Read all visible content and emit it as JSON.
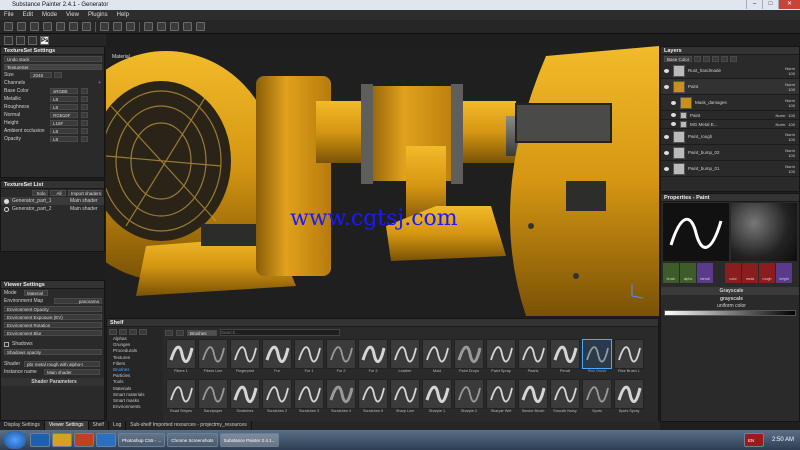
{
  "window": {
    "title": "Substance Painter 2.4.1 - Generator",
    "controls": [
      "–",
      "□",
      "✕"
    ]
  },
  "menu": [
    "File",
    "Edit",
    "Mode",
    "View",
    "Plugins",
    "Help"
  ],
  "toolbar2": {
    "ps_label": "Ps"
  },
  "textureset_settings": {
    "title": "TextureSet Settings",
    "undo_stack": "Undo stack",
    "textureset": "TextureSet",
    "size_label": "Size",
    "size_value": "2048",
    "channels_label": "Channels",
    "channels": [
      {
        "name": "Base Color",
        "format": "sRGB8"
      },
      {
        "name": "Metallic",
        "format": "L8"
      },
      {
        "name": "Roughness",
        "format": "L8"
      },
      {
        "name": "Normal",
        "format": "RGB16F"
      },
      {
        "name": "Height",
        "format": "L16F"
      },
      {
        "name": "Ambient occlusion",
        "format": "L8"
      },
      {
        "name": "Opacity",
        "format": "L8"
      }
    ]
  },
  "textureset_list": {
    "title": "TextureSet List",
    "buttons": [
      "Solo",
      "All",
      "Import shaders"
    ],
    "items": [
      {
        "name": "Generator_part_1",
        "shader": "Main shader"
      },
      {
        "name": "Generator_part_2",
        "shader": "Main shader"
      }
    ]
  },
  "viewer_settings": {
    "title": "Viewer Settings",
    "mode_label": "Mode",
    "mode_value": "Material",
    "env_map_label": "Environment Map",
    "env_map_value": "panorama",
    "fields": [
      "Environment Opacity",
      "Environment Exposure (EV)",
      "Environment Rotation",
      "Environment Blur"
    ],
    "shadows_label": "Shadows",
    "shadows_opacity": "Shadows opacity",
    "shader_label": "Shader",
    "shader_value": "pbr metal rough with alpha-t",
    "instance_label": "Instance name",
    "instance_value": "Main shader",
    "shader_params": "Shader Parameters"
  },
  "viewport": {
    "label": "Material",
    "watermark": "www.cgtsj.com"
  },
  "shelf": {
    "title": "Shelf",
    "filter_chip": "Brushes",
    "search_placeholder": "Search...",
    "categories": [
      "Alphas",
      "Grunges",
      "Procedurals",
      "Textures",
      "Filters",
      "Brushes",
      "Particles",
      "Tools",
      "Materials",
      "Smart materials",
      "Smart masks",
      "Environments"
    ],
    "active_category": "Brushes",
    "row1": [
      "Fibers 1",
      "Fibers Line",
      "Fingerprint",
      "Fur",
      "Fur 1",
      "Fur 2",
      "Fur 3",
      "Leather",
      "Mold",
      "Paint Drops",
      "Paint Spray",
      "Pearls",
      "Pencil",
      "Rice Brush",
      "Rice Brush L"
    ],
    "row2": [
      "Road Stripes",
      "Sandpaper",
      "Scratches",
      "Scratches 2",
      "Scratches 3",
      "Scratches 4",
      "Scratches 5",
      "Sharp Line",
      "Sharpie 1",
      "Sharpie 2",
      "Sharpie Wet",
      "Smoke Brush",
      "Smooth Noisy",
      "Spots",
      "Spots Spray"
    ],
    "selected": "Rice Brush"
  },
  "bottom_tabs": [
    "Display Settings",
    "Viewer Settings",
    "Shelf",
    "Log",
    "Sub-shelf Imported resources - projectmy_resources"
  ],
  "active_bottom_tab": "Viewer Settings",
  "layers": {
    "title": "Layers",
    "channel": "Base Color",
    "items": [
      {
        "name": "Rust_handmade",
        "blend": "Norm",
        "opacity": "100"
      },
      {
        "name": "Paint",
        "blend": "Norm",
        "opacity": "100"
      },
      {
        "name": "Mask_damages",
        "blend": "Norm",
        "opacity": "100"
      },
      {
        "name": "Paint",
        "blend": "Norm",
        "opacity": "100"
      },
      {
        "name": "MG Metal E...",
        "blend": "Norm",
        "opacity": "100"
      },
      {
        "name": "Paint_rough",
        "blend": "Norm",
        "opacity": "100"
      },
      {
        "name": "Paint_bump_02",
        "blend": "Norm",
        "opacity": "100"
      },
      {
        "name": "Paint_bump_01",
        "blend": "Norm",
        "opacity": "100"
      }
    ]
  },
  "properties": {
    "title": "Properties - Paint",
    "brush_tabs": [
      "brush",
      "alpha",
      "stencil"
    ],
    "mat_tabs": [
      "color",
      "metal",
      "rough",
      "height"
    ],
    "grayscale_title": "Grayscale",
    "grayscale_label": "grayscale",
    "uniform": "uniform color"
  },
  "taskbar": {
    "apps": [
      "Photoshop CS5 - ...",
      "Chrome Screenshots",
      "Substance Painter 2.4.1..."
    ],
    "clock": "2:50 AM",
    "lang": "EN"
  },
  "colors": {
    "accent": "#2a8fd4",
    "panel": "#2a2a2a",
    "watermark": "#1a1aff"
  }
}
